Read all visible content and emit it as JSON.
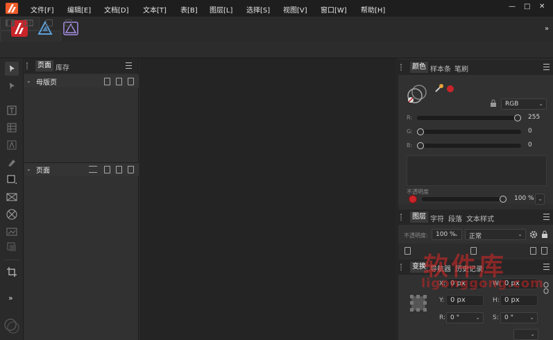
{
  "menu": {
    "items": [
      "文件[F]",
      "编辑[E]",
      "文档[D]",
      "文本[T]",
      "表[B]",
      "图层[L]",
      "选择[S]",
      "视图[V]",
      "窗口[W]",
      "帮助[H]"
    ],
    "min_label": "—",
    "max_label": "□",
    "close_label": "✕"
  },
  "toolbar": {
    "overflow_label": "»"
  },
  "colors": {
    "accent_red": "#c8242a",
    "publisher_orange": "#f05a28",
    "designer_blue": "#3b8bc9",
    "photo_purple": "#8d6fd1"
  },
  "tools": {
    "expand_label": "»"
  },
  "pages_panel": {
    "tabs": [
      "页面",
      "库存"
    ],
    "masters_label": "母版页",
    "pages_label": "页面"
  },
  "color_panel": {
    "tabs": [
      "颜色",
      "样本条",
      "笔刷"
    ],
    "mode": "RGB",
    "r_label": "R:",
    "g_label": "G:",
    "b_label": "B:",
    "r_value": "255",
    "g_value": "0",
    "b_value": "0",
    "r_level": 1.0,
    "g_level": 0.0,
    "b_level": 0.0,
    "opacity_label": "不透明度",
    "opacity_value": "100 %",
    "opacity_level": 1.0
  },
  "layers_panel": {
    "tabs": [
      "图层",
      "字符",
      "段落",
      "文本样式"
    ],
    "opacity_label": "不透明度:",
    "opacity_value": "100 %",
    "blend_mode": "正常"
  },
  "transform_panel": {
    "tabs": [
      "变换",
      "导航器",
      "历史记录"
    ],
    "x_label": "X:",
    "x_value": "0 px",
    "y_label": "Y:",
    "y_value": "0 px",
    "w_label": "W:",
    "w_value": "0 px",
    "h_label": "H:",
    "h_value": "0 px",
    "r_label": "R:",
    "r_value": "0 °",
    "s_label": "S:",
    "s_value": "0 °"
  },
  "watermark": {
    "title": "软件库",
    "url": "ligonggong.com"
  }
}
